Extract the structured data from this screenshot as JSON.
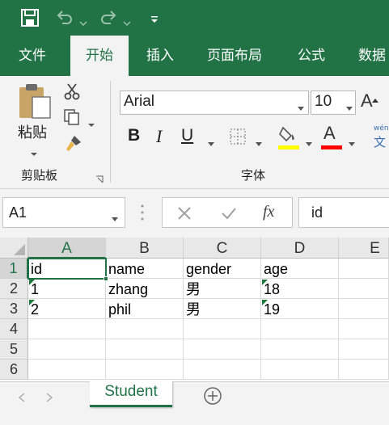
{
  "ribbon_tabs": [
    "文件",
    "开始",
    "插入",
    "页面布局",
    "公式",
    "数据"
  ],
  "ribbon": {
    "clipboard": {
      "paste_label": "粘贴",
      "group_label": "剪贴板"
    },
    "font": {
      "name": "Arial",
      "size": "10",
      "bold": "B",
      "italic": "I",
      "underline": "U",
      "font_color_glyph": "A",
      "grow_glyph": "A",
      "group_label": "字体",
      "phonetic_top": "wén",
      "phonetic_bottom": "文"
    },
    "fill_color": "#ffff00",
    "font_color": "#ff0000"
  },
  "formula_bar": {
    "name_box": "A1",
    "content": "id",
    "fx": "fx"
  },
  "columns": [
    "A",
    "B",
    "C",
    "D",
    "E"
  ],
  "rows": [
    "1",
    "2",
    "3",
    "4",
    "5",
    "6"
  ],
  "cells": [
    [
      "id",
      "name",
      "gender",
      "age"
    ],
    [
      "1",
      "zhang",
      "男",
      "18"
    ],
    [
      "2",
      "phil",
      "男",
      "19"
    ]
  ],
  "sheet_tab": "Student",
  "accent_color": "#217346"
}
